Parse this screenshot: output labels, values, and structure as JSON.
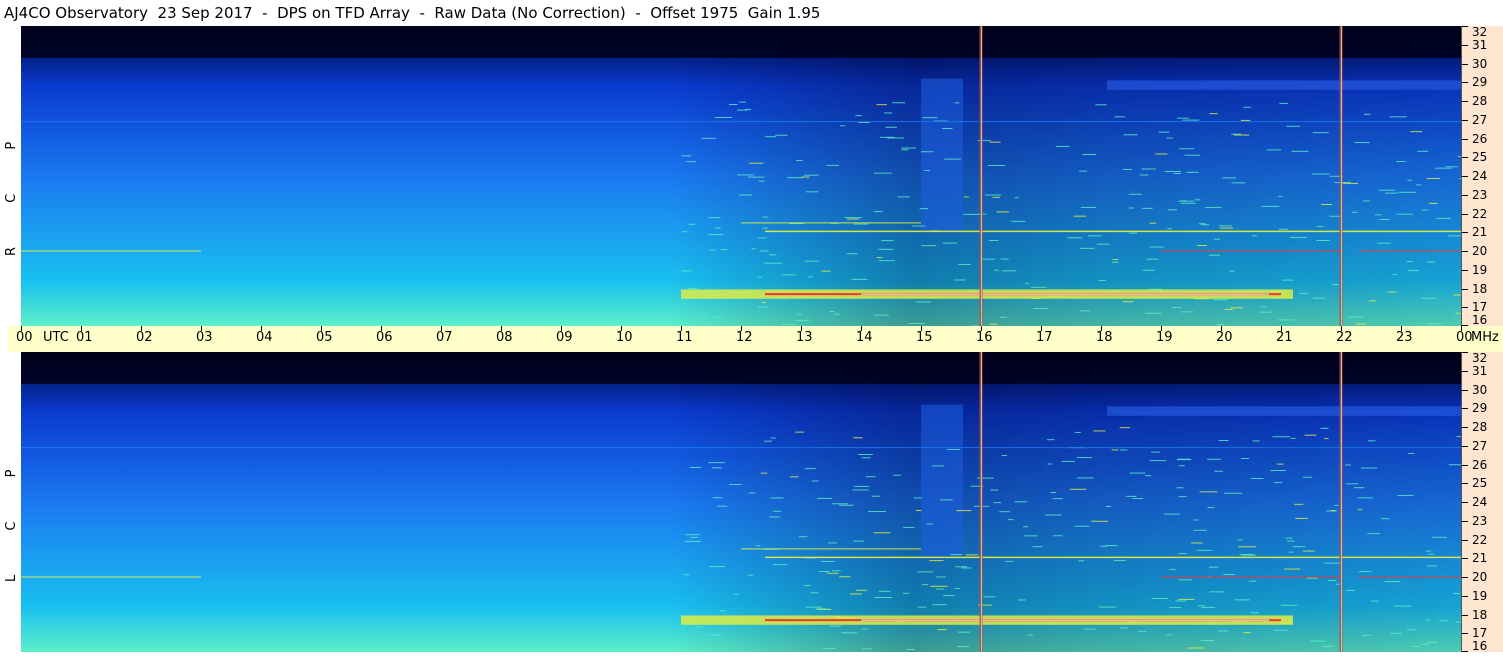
{
  "title": "AJ4CO Observatory  23 Sep 2017  -  DPS on TFD Array  -  Raw Data (No Correction)  -  Offset 1975  Gain 1.95",
  "chart_data": {
    "type": "heatmap",
    "panels": [
      {
        "name": "RCP",
        "label": "R  C  P"
      },
      {
        "name": "LCP",
        "label": "L  C  P"
      }
    ],
    "x_axis": {
      "unit_label": "UTC",
      "ticks": [
        "00",
        "01",
        "02",
        "03",
        "04",
        "05",
        "06",
        "07",
        "08",
        "09",
        "10",
        "11",
        "12",
        "13",
        "14",
        "15",
        "16",
        "17",
        "18",
        "19",
        "20",
        "21",
        "22",
        "23",
        "00"
      ],
      "range_hours": [
        0,
        24
      ]
    },
    "y_axis": {
      "unit_label": "MHz",
      "range": [
        16,
        32
      ],
      "ticks": [
        "16",
        "17",
        "18",
        "19",
        "20",
        "21",
        "22",
        "23",
        "24",
        "25",
        "26",
        "27",
        "28",
        "29",
        "30",
        "31",
        "32"
      ]
    },
    "colormap": [
      "#000020",
      "#001060",
      "#0a3bd0",
      "#1a78f0",
      "#19c0f0",
      "#5cf0c8",
      "#e8f040",
      "#ff3030",
      "#ffffff"
    ],
    "vertical_marker_lines_utc": [
      16.0,
      22.0
    ],
    "strong_horizontal_band_mhz": 17.7,
    "grid": false
  }
}
